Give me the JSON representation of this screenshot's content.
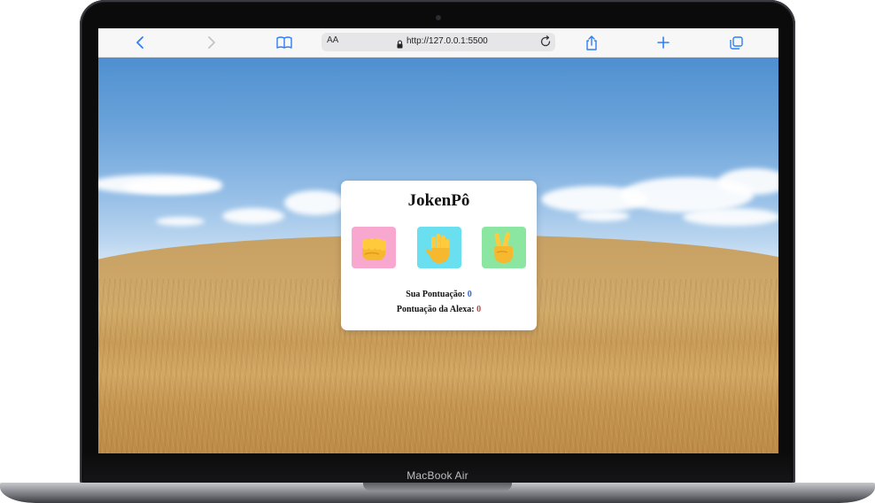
{
  "device": {
    "model_label": "MacBook Air"
  },
  "browser": {
    "address_text_size": "AA",
    "url": "http://127.0.0.1:5500",
    "icons": [
      "back-icon",
      "forward-icon",
      "bookmarks-icon",
      "lock-icon",
      "reload-icon",
      "share-icon",
      "new-tab-icon",
      "tabs-icon"
    ]
  },
  "game": {
    "title": "JokenPô",
    "choices": [
      {
        "name": "rock",
        "emoji": "👊",
        "bg_color": "#f8a7cf"
      },
      {
        "name": "paper",
        "emoji": "🖐",
        "bg_color": "#69dff0"
      },
      {
        "name": "scissors",
        "emoji": "✌",
        "bg_color": "#8be6a2"
      }
    ],
    "user_score_label": "Sua Pontuação:",
    "user_score": "0",
    "cpu_score_label": "Pontuação da Alexa:",
    "cpu_score": "0"
  },
  "colors": {
    "accent": "#2f7ff6",
    "user_score": "#2f63d6",
    "cpu_score": "#d63a2f"
  }
}
